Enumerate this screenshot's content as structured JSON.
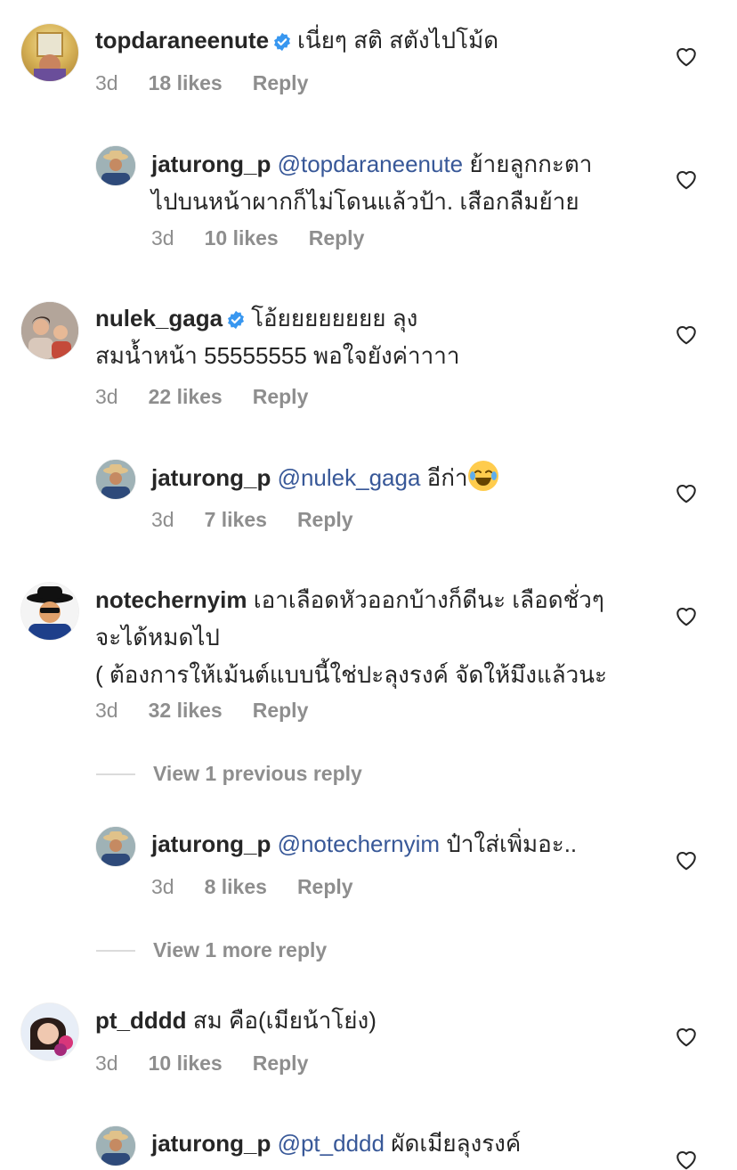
{
  "comments": [
    {
      "username": "topdaraneenute",
      "verified": true,
      "text": "เนี่ยๆ สติ สตังไปโม้ด",
      "time": "3d",
      "likes": "18 likes",
      "reply": "Reply"
    },
    {
      "username": "jaturong_p",
      "mention": "@topdaraneenute",
      "text_line1": "ย้ายลูกกะตา",
      "text_line2": "ไปบนหน้าผากก็ไม่โดนแล้วป้า. เสือกลืมย้าย",
      "time": "3d",
      "likes": "10 likes",
      "reply": "Reply"
    },
    {
      "username": "nulek_gaga",
      "verified": true,
      "text_line1": "โอ้ยยยยยยยย ลุง",
      "text_line2": "สมน้ำหน้า 55555555 พอใจยังค่าาาา",
      "time": "3d",
      "likes": "22 likes",
      "reply": "Reply"
    },
    {
      "username": "jaturong_p",
      "mention": "@nulek_gaga",
      "text": "อีก่า",
      "time": "3d",
      "likes": "7 likes",
      "reply": "Reply"
    },
    {
      "username": "notechernyim",
      "text_line1": "เอาเลือดหัวออกบ้างก็ดีนะ เลือดชั่วๆ",
      "text_line2": "จะได้หมดไป",
      "text_line3": "( ต้องการให้เม้นต์แบบนี้ใช่ปะลุงรงค์ จัดให้มึงแล้วนะ",
      "time": "3d",
      "likes": "32 likes",
      "reply": "Reply"
    },
    {
      "username": "jaturong_p",
      "mention": "@notechernyim",
      "text": "ป๋าใส่เพิ่มอะ..",
      "time": "3d",
      "likes": "8 likes",
      "reply": "Reply"
    },
    {
      "username": "pt_dddd",
      "text": "สม คือ(เมียน้าโย่ง)",
      "time": "3d",
      "likes": "10 likes",
      "reply": "Reply"
    },
    {
      "username": "jaturong_p",
      "mention": "@pt_dddd",
      "text": "ผัดเมียลุงรงค์"
    }
  ],
  "view_previous": "View 1 previous reply",
  "view_more": "View 1 more reply",
  "colors": {
    "mention": "#385898",
    "meta": "#8e8e8e",
    "verified": "#3897f0"
  },
  "icons": {
    "like": "heart-outline-icon",
    "verified": "verified-badge-icon"
  }
}
